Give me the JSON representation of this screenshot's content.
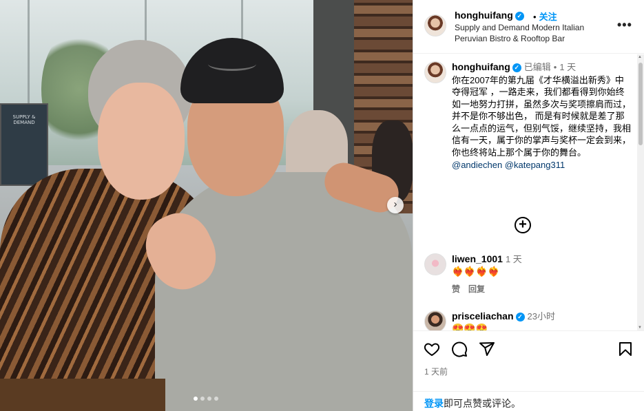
{
  "photo": {
    "carousel_next_label": "›",
    "sign_text": "SUPPLY & DEMAND",
    "dots_count": 4,
    "active_dot": 1
  },
  "header": {
    "username": "honghuifang",
    "verified_mark": "✓",
    "separator": "•",
    "follow_label": "关注",
    "location": "Supply and Demand Modern Italian Peruvian Bistro & Rooftop Bar",
    "more_label": "•••"
  },
  "caption": {
    "username": "honghuifang",
    "edited": "已编辑",
    "separator": "•",
    "time": "1 天",
    "text": "你在2007年的第九届《才华横溢出新秀》中夺得冠军 ，一路走来，我们都看得到你始终如一地努力打拼，虽然多次与奖项擦肩而过，并不是你不够出色， 而是有时候就是差了那么一点点的运气，但别气馁，继续坚持，我相信有一天，属于你的掌声与奖杯一定会到来，你也终将站上那个属于你的舞台。",
    "mentions": "@andiechen @katepang311",
    "load_more_label": "+"
  },
  "comments": [
    {
      "username": "liwen_1001",
      "time": "1 天",
      "text": "❤️‍🔥❤️‍🔥❤️‍🔥❤️‍🔥",
      "like_label": "赞",
      "reply_label": "回复",
      "verified": false
    },
    {
      "username": "prisceliachan",
      "time": "23小时",
      "text": "😍😍😍",
      "verified": true
    }
  ],
  "actions": {
    "like_icon": "heart-icon",
    "comment_icon": "comment-icon",
    "share_icon": "share-icon",
    "save_icon": "bookmark-icon",
    "date": "1 天前"
  },
  "login": {
    "link": "登录",
    "rest": "即可点赞或评论。"
  },
  "colors": {
    "accent": "#0095f6",
    "muted": "#737373",
    "mention": "#00376b"
  }
}
